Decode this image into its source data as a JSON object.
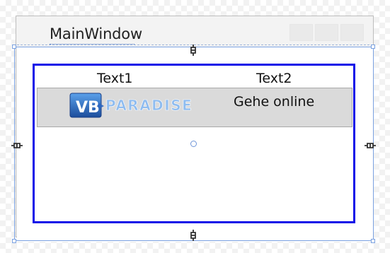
{
  "window": {
    "title": "MainWindow"
  },
  "grid": {
    "columns": [
      "Text1",
      "Text2"
    ],
    "rows": [
      {
        "col1_logo_text": "PARADISE",
        "col1_logo_badge": "VB",
        "col2": "Gehe online"
      }
    ]
  },
  "colors": {
    "grid_border": "#1010e8",
    "selection": "#7aa1e0",
    "row_background": "#dadada"
  },
  "icons": {
    "anchor_top": "link-anchor-icon",
    "anchor_left": "link-anchor-icon",
    "anchor_right": "link-anchor-icon",
    "anchor_bottom": "link-anchor-icon",
    "center": "circle-handle-icon"
  }
}
